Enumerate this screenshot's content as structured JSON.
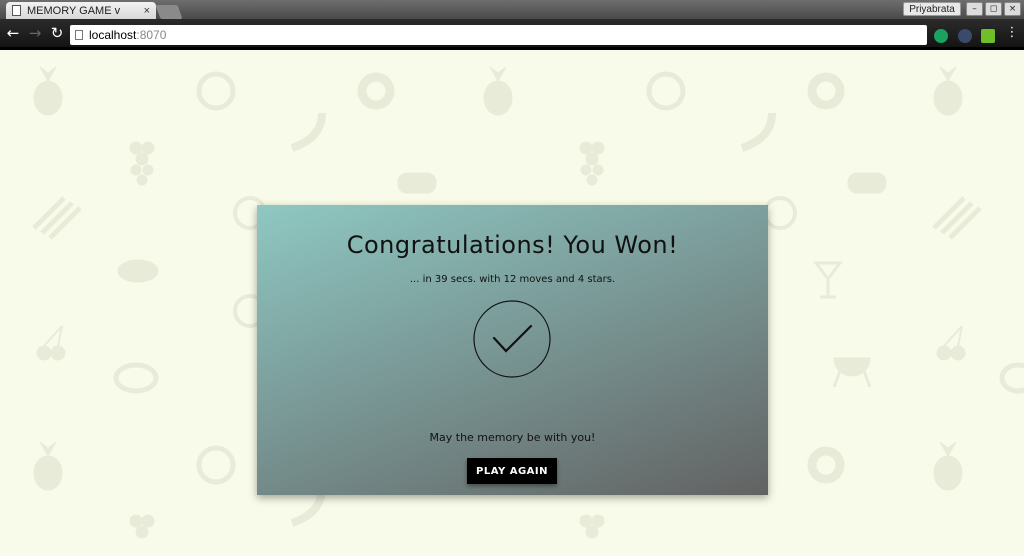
{
  "browser": {
    "tab_title": "MEMORY GAME v",
    "tab_close": "×",
    "user_name": "Priyabrata",
    "url_host": "localhost",
    "url_port": ":8070",
    "back": "←",
    "forward": "→",
    "reload": "↻",
    "win_min": "–",
    "win_max": "◻",
    "win_close": "×"
  },
  "modal": {
    "title": "Congratulations! You Won!",
    "subtitle": "... in 39 secs. with 12 moves and 4 stars.",
    "motto": "May the memory be with you!",
    "play_again_label": "PLAY AGAIN"
  },
  "stats": {
    "seconds": 39,
    "moves": 12,
    "stars": 4
  },
  "colors": {
    "page_background": "#f8fbe9",
    "pattern_icon": "#e8ebd8",
    "modal_gradient_start": "#8fc8c2",
    "modal_gradient_end": "#626262",
    "button_bg": "#000000"
  },
  "background_icons": [
    "pineapple-icon",
    "watermelon-icon",
    "donut-icon",
    "banana-icon",
    "grapes-icon",
    "sushi-icon",
    "asparagus-icon",
    "lemon-icon",
    "chicken-icon",
    "cocktail-icon",
    "cherries-icon",
    "bbq-grill-icon"
  ]
}
